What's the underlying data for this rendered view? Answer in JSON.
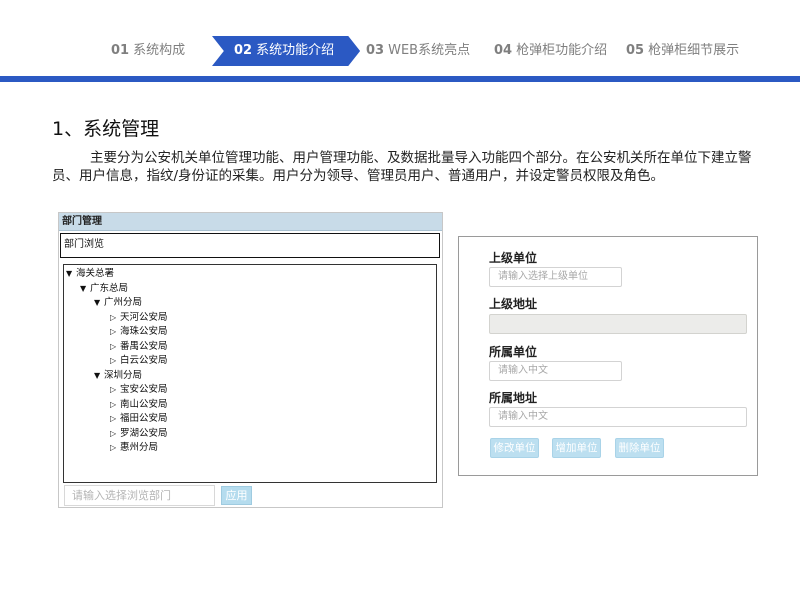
{
  "nav": {
    "items": [
      {
        "num": "01",
        "label": "系统构成",
        "active": false
      },
      {
        "num": "02",
        "label": "系统功能介绍",
        "active": true
      },
      {
        "num": "03",
        "label": "WEB系统亮点",
        "active": false
      },
      {
        "num": "04",
        "label": "枪弹柜功能介绍",
        "active": false
      },
      {
        "num": "05",
        "label": "枪弹柜细节展示",
        "active": false
      }
    ]
  },
  "section": {
    "title": "1、系统管理",
    "description": "主要分为公安机关单位管理功能、用户管理功能、及数据批量导入功能四个部分。在公安机关所在单位下建立警员、用户信息，指纹/身份证的采集。用户分为领导、管理员用户、普通用户，并设定警员权限及角色。"
  },
  "dept_panel": {
    "header": "部门管理",
    "browse_label": "部门浏览",
    "tree": [
      {
        "label": "海关总署",
        "level": 1,
        "expanded": true
      },
      {
        "label": "广东总局",
        "level": 2,
        "expanded": true
      },
      {
        "label": "广州分局",
        "level": 3,
        "expanded": true
      },
      {
        "label": "天河公安局",
        "level": 4,
        "expanded": false
      },
      {
        "label": "海珠公安局",
        "level": 4,
        "expanded": false
      },
      {
        "label": "番禺公安局",
        "level": 4,
        "expanded": false
      },
      {
        "label": "白云公安局",
        "level": 4,
        "expanded": false
      },
      {
        "label": "深圳分局",
        "level": 3,
        "expanded": true
      },
      {
        "label": "宝安公安局",
        "level": 4,
        "expanded": false
      },
      {
        "label": "南山公安局",
        "level": 4,
        "expanded": false
      },
      {
        "label": "福田公安局",
        "level": 4,
        "expanded": false
      },
      {
        "label": "罗湖公安局",
        "level": 4,
        "expanded": false
      },
      {
        "label": "惠州分局",
        "level": 4,
        "expanded": false
      }
    ],
    "search_placeholder": "请输入选择浏览部门",
    "apply_label": "应用"
  },
  "unit_panel": {
    "parent_unit_label": "上级单位",
    "parent_unit_placeholder": "请输入选择上级单位",
    "parent_address_label": "上级地址",
    "parent_address_value": "",
    "unit_label": "所属单位",
    "unit_placeholder": "请输入中文",
    "address_label": "所属地址",
    "address_placeholder": "请输入中文",
    "modify_button": "修改单位",
    "add_button": "增加单位",
    "delete_button": "删除单位"
  },
  "colors": {
    "accent": "#2b59c3",
    "button_light": "#bcdff0",
    "header_bg": "#c8dbe8"
  }
}
